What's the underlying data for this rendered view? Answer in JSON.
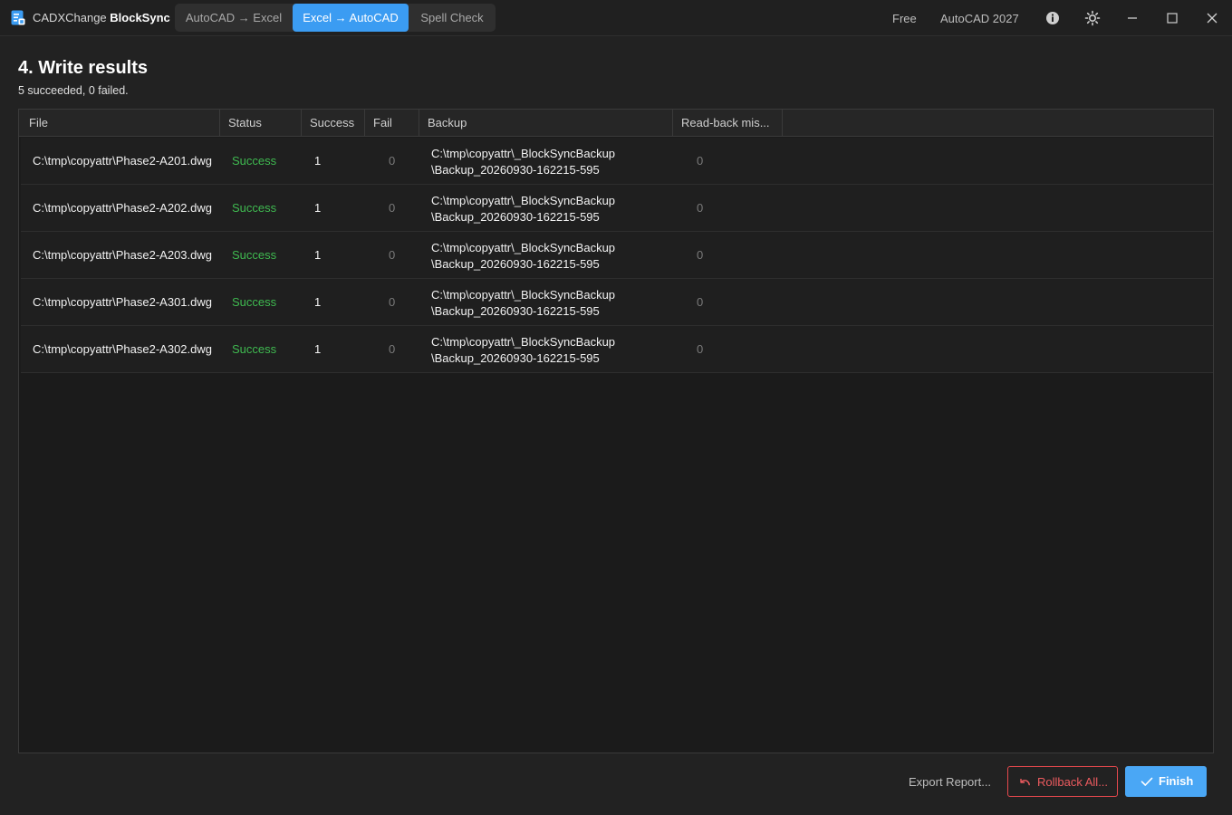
{
  "app": {
    "name_prefix": "CADXChange",
    "name_bold": "BlockSync",
    "tabs": [
      {
        "label": "AutoCAD → Excel",
        "active": false
      },
      {
        "label": "Excel → AutoCAD",
        "active": true
      },
      {
        "label": "Spell Check",
        "active": false
      }
    ],
    "license": "Free",
    "host_version": "AutoCAD 2027",
    "icons": [
      "info-icon",
      "theme-sun-icon",
      "minimize-icon",
      "maximize-icon",
      "close-icon"
    ],
    "accent_color": "#3b9cf2"
  },
  "page": {
    "title": "4. Write results",
    "summary": "5 succeeded, 0 failed."
  },
  "table": {
    "columns": [
      "File",
      "Status",
      "Success",
      "Fail",
      "Backup",
      "Read-back mis..."
    ],
    "rows": [
      {
        "file": "C:\\tmp\\copyattr\\Phase2-A201.dwg",
        "status": "Success",
        "success": "1",
        "fail": "0",
        "backup_line1": "C:\\tmp\\copyattr\\_BlockSyncBackup",
        "backup_line2": "\\Backup_20260930-162215-595",
        "readback": "0"
      },
      {
        "file": "C:\\tmp\\copyattr\\Phase2-A202.dwg",
        "status": "Success",
        "success": "1",
        "fail": "0",
        "backup_line1": "C:\\tmp\\copyattr\\_BlockSyncBackup",
        "backup_line2": "\\Backup_20260930-162215-595",
        "readback": "0"
      },
      {
        "file": "C:\\tmp\\copyattr\\Phase2-A203.dwg",
        "status": "Success",
        "success": "1",
        "fail": "0",
        "backup_line1": "C:\\tmp\\copyattr\\_BlockSyncBackup",
        "backup_line2": "\\Backup_20260930-162215-595",
        "readback": "0"
      },
      {
        "file": "C:\\tmp\\copyattr\\Phase2-A301.dwg",
        "status": "Success",
        "success": "1",
        "fail": "0",
        "backup_line1": "C:\\tmp\\copyattr\\_BlockSyncBackup",
        "backup_line2": "\\Backup_20260930-162215-595",
        "readback": "0"
      },
      {
        "file": "C:\\tmp\\copyattr\\Phase2-A302.dwg",
        "status": "Success",
        "success": "1",
        "fail": "0",
        "backup_line1": "C:\\tmp\\copyattr\\_BlockSyncBackup",
        "backup_line2": "\\Backup_20260930-162215-595",
        "readback": "0"
      }
    ],
    "status_color": "#3fb950"
  },
  "footer": {
    "export_label": "Export Report...",
    "rollback_label": "Rollback All...",
    "finish_label": "Finish",
    "rollback_color": "#e5484d",
    "finish_color": "#4aa7f5"
  }
}
